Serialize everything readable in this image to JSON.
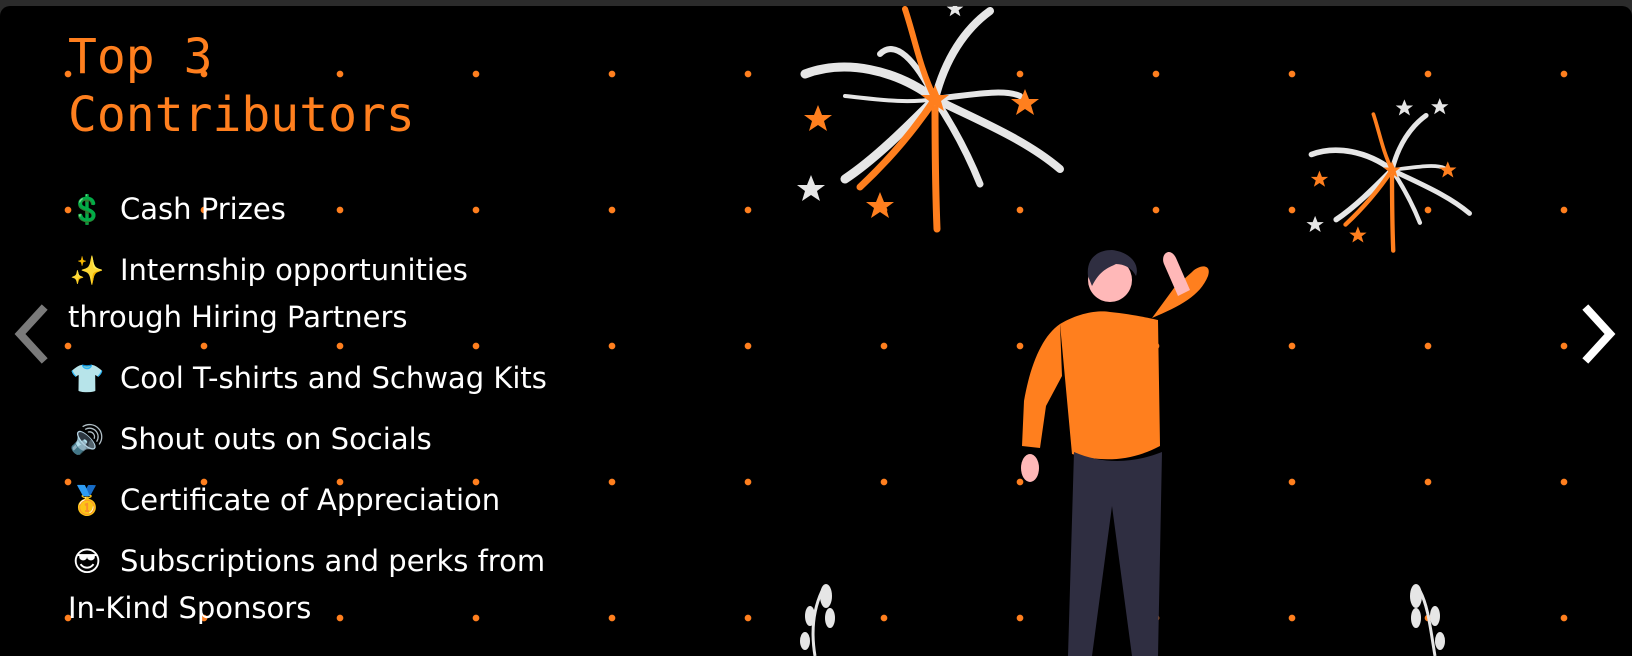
{
  "carousel": {
    "title": "Top 3 Contributors",
    "perks": [
      {
        "icon": "dollar-sign-icon",
        "glyph": "💲",
        "text": "Cash Prizes"
      },
      {
        "icon": "sparkles-icon",
        "glyph": "✨",
        "text": "Internship opportunities through Hiring Partners"
      },
      {
        "icon": "tshirt-icon",
        "glyph": "👕",
        "text": "Cool T-shirts and Schwag Kits"
      },
      {
        "icon": "speaker-icon",
        "glyph": "🔊",
        "text": "Shout outs on Socials"
      },
      {
        "icon": "medal-icon",
        "glyph": "🥇",
        "text": "Certificate of Appreciation"
      },
      {
        "icon": "sunglasses-face-icon",
        "glyph": "😎",
        "text": "Subscriptions and perks from In-Kind Sponsors"
      }
    ],
    "prev_icon": "chevron-left-icon",
    "next_icon": "chevron-right-icon"
  },
  "colors": {
    "accent": "#ff7f1e",
    "background": "#000000",
    "text": "#ffffff",
    "pants": "#2f2e41",
    "skin": "#ffb8b8",
    "hair": "#2f2e41",
    "firework_light": "#e6e6e6"
  },
  "illustration": {
    "icon": "celebrating-person-with-fireworks-illustration"
  }
}
